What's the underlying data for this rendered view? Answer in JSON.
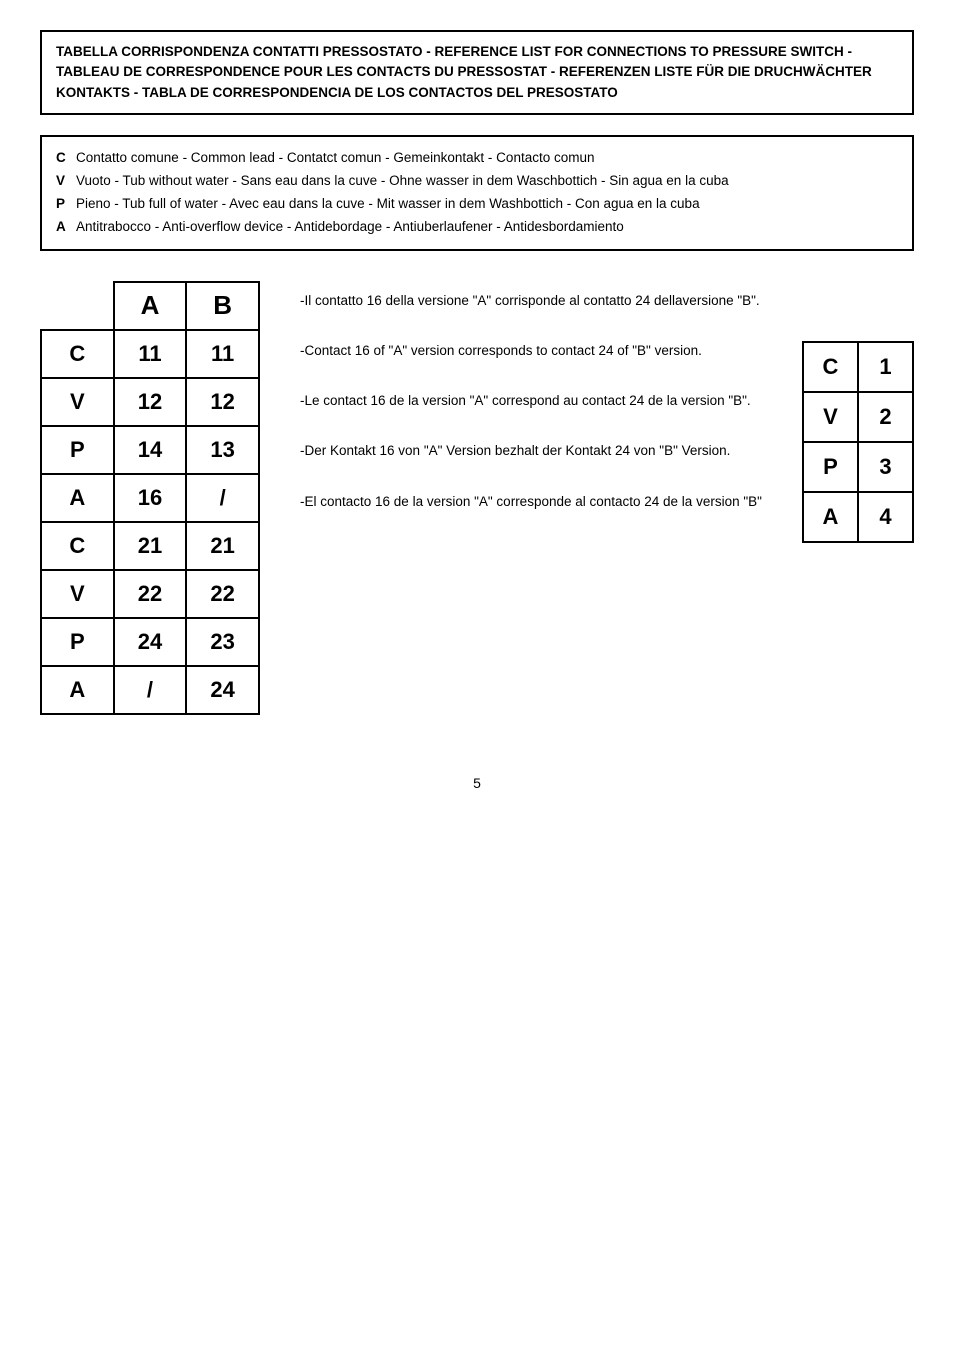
{
  "header": {
    "text": "TABELLA CORRISPONDENZA CONTATTI PRESSOSTATO - REFERENCE LIST FOR CONNECTIONS TO PRESSURE SWITCH - TABLEAU DE CORRESPONDENCE POUR LES CONTACTS DU PRESSOSTAT - REFERENZEN LISTE FÜR DIE DRUCHWÄCHTER KONTAKTS - TABLA DE CORRESPONDENCIA DE LOS CONTACTOS DEL PRESOSTATO"
  },
  "legend": {
    "items": [
      {
        "key": "C",
        "text": "Contatto comune - Common lead - Contatct comun - Gemeinkontakt - Contacto comun"
      },
      {
        "key": "V",
        "text": "Vuoto - Tub without water - Sans eau dans la cuve - Ohne wasser in dem Waschbottich - Sin agua en la cuba"
      },
      {
        "key": "P",
        "text": "Pieno - Tub full of water - Avec eau dans la cuve - Mit wasser in dem Washbottich - Con agua en la cuba"
      },
      {
        "key": "A",
        "text": "Antitrabocco - Anti-overflow device - Antidebordage - Antiuberlaufener - Antidesbordamiento"
      }
    ]
  },
  "main_table": {
    "headers": [
      "",
      "A",
      "B"
    ],
    "rows": [
      {
        "label": "C",
        "a": "11",
        "b": "11"
      },
      {
        "label": "V",
        "a": "12",
        "b": "12"
      },
      {
        "label": "P",
        "a": "14",
        "b": "13"
      },
      {
        "label": "A",
        "a": "16",
        "b": "/"
      },
      {
        "label": "C",
        "a": "21",
        "b": "21"
      },
      {
        "label": "V",
        "a": "22",
        "b": "22"
      },
      {
        "label": "P",
        "a": "24",
        "b": "23"
      },
      {
        "label": "A",
        "a": "/",
        "b": "24"
      }
    ]
  },
  "small_table": {
    "rows": [
      {
        "label": "C",
        "val": "1"
      },
      {
        "label": "V",
        "val": "2"
      },
      {
        "label": "P",
        "val": "3"
      },
      {
        "label": "A",
        "val": "4"
      }
    ]
  },
  "notes": [
    {
      "text": "-Il contatto 16 della versione \"A\" corrisponde al contatto 24 dellaversione \"B\"."
    },
    {
      "text": "-Contact 16 of \"A\" version corresponds to contact 24 of \"B\" version."
    },
    {
      "text": "-Le contact 16 de la version \"A\" correspond au contact 24 de la version \"B\"."
    },
    {
      "text": "-Der Kontakt 16 von \"A\" Version bezhalt der Kontakt 24 von \"B\" Version."
    },
    {
      "text": "-El contacto 16 de la version \"A\" corresponde al contacto 24 de la version \"B\""
    }
  ],
  "page_number": "5"
}
